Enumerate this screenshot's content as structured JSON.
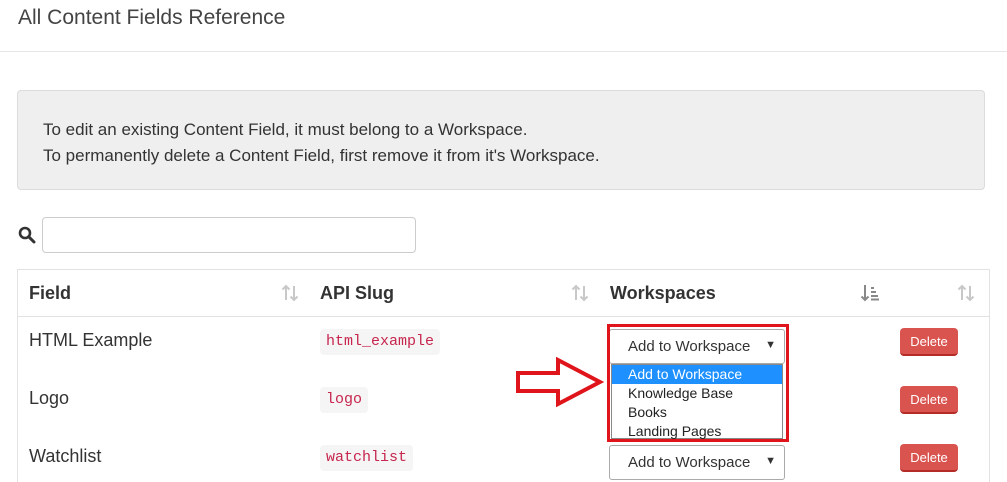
{
  "page": {
    "title": "All Content Fields Reference"
  },
  "notice": {
    "line1": "To edit an existing Content Field, it must belong to a Workspace.",
    "line2": "To permanently delete a Content Field, first remove it from it's Workspace."
  },
  "search": {
    "icon": "search-icon",
    "value": ""
  },
  "table": {
    "headers": {
      "field": "Field",
      "slug": "API Slug",
      "workspaces": "Workspaces"
    },
    "rows": [
      {
        "field": "HTML Example",
        "slug": "html_example",
        "select_value": "Add to Workspace",
        "delete_label": "Delete"
      },
      {
        "field": "Logo",
        "slug": "logo",
        "select_value": "Add to Workspace",
        "delete_label": "Delete"
      },
      {
        "field": "Watchlist",
        "slug": "watchlist",
        "select_value": "Add to Workspace",
        "delete_label": "Delete"
      }
    ]
  },
  "dropdown": {
    "options": [
      "Add to Workspace",
      "Knowledge Base",
      "Books",
      "Landing Pages"
    ],
    "selected": "Add to Workspace"
  },
  "colors": {
    "annotation": "#e0151b",
    "delete_button": "#d9534f",
    "slug_text": "#c7254e",
    "selected_option": "#1e90ff"
  }
}
